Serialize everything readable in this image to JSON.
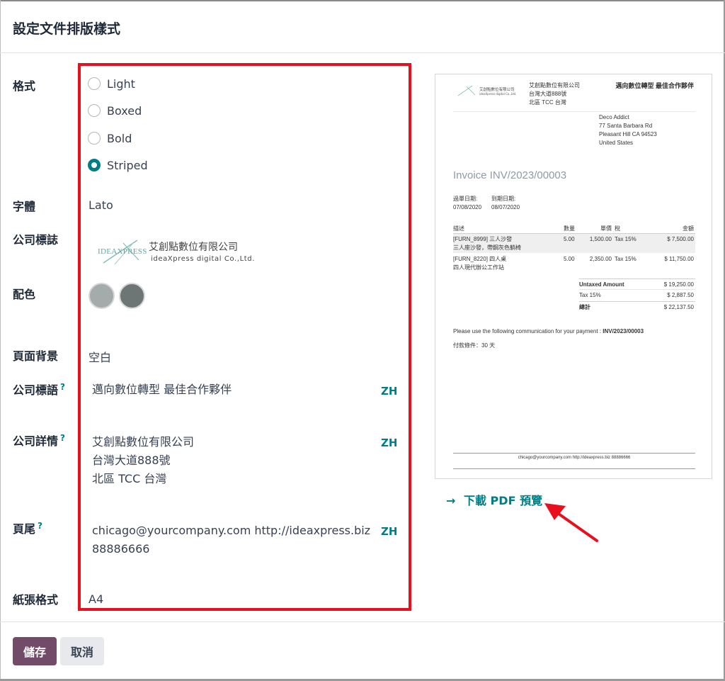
{
  "dialog": {
    "title": "設定文件排版樣式"
  },
  "fields": {
    "layout": {
      "label": "格式",
      "options": [
        "Light",
        "Boxed",
        "Bold",
        "Striped"
      ],
      "selected": "Striped"
    },
    "font": {
      "label": "字體",
      "value": "Lato"
    },
    "logo": {
      "label": "公司標誌",
      "logo_wordmark": "IDEAXPRESS",
      "logo_name_zh": "艾創點數位有限公司",
      "logo_name_en": "ideaXpress digital Co.,Ltd."
    },
    "colors": {
      "label": "配色",
      "primary": "#a3abab",
      "secondary": "#6d7675"
    },
    "background": {
      "label": "頁面背景",
      "value": "空白"
    },
    "tagline": {
      "label": "公司標語",
      "help": "?",
      "value": "邁向數位轉型 最佳合作夥伴",
      "lang": "ZH"
    },
    "company_details": {
      "label": "公司詳情",
      "help": "?",
      "lines": [
        "艾創點數位有限公司",
        "台灣大道888號",
        "北區 TCC 台灣"
      ],
      "lang": "ZH"
    },
    "footer": {
      "label": "頁尾",
      "help": "?",
      "lines": [
        "chicago@yourcompany.com http://ideaxpress.biz",
        "88886666"
      ],
      "lang": "ZH"
    },
    "paper_format": {
      "label": "紙張格式",
      "value": "A4"
    }
  },
  "preview": {
    "logo_name_zh": "艾創點數位有限公司",
    "logo_name_en": "ideaXpress digital Co.,Ltd.",
    "company_lines": [
      "艾創點數位有限公司",
      "台灣大道888號",
      "北區 TCC 台灣"
    ],
    "tagline": "邁向數位轉型 最佳合作夥伴",
    "address_lines": [
      "Deco Addict",
      "77 Santa Barbara Rd",
      "Pleasant Hill CA 94523",
      "United States"
    ],
    "invoice_title": "Invoice INV/2023/00003",
    "invoice_date_label": "過單日期:",
    "invoice_date": "07/08/2020",
    "due_date_label": "到期日期:",
    "due_date": "08/07/2020",
    "table_headers": {
      "description": "描述",
      "quantity": "數量",
      "unit_price": "單價",
      "taxes": "稅",
      "amount": "金額"
    },
    "lines": [
      {
        "desc1": "[FURN_8999] 三人沙發",
        "desc2": "三人座沙發，帶鋼灰色躺椅",
        "qty": "5.00",
        "price": "1,500.00",
        "tax": "Tax 15%",
        "amount": "$ 7,500.00"
      },
      {
        "desc1": "[FURN_8220] 四人桌",
        "desc2": "四人現代辦公工作站",
        "qty": "5.00",
        "price": "2,350.00",
        "tax": "Tax 15%",
        "amount": "$ 11,750.00"
      }
    ],
    "totals": {
      "untaxed_label": "Untaxed Amount",
      "untaxed": "$ 19,250.00",
      "tax_label": "Tax 15%",
      "tax": "$ 2,887.50",
      "total_label": "總計",
      "total": "$ 22,137.50"
    },
    "payment_comm_text": "Please use the following communication for your payment :",
    "payment_comm_ref": "INV/2023/00003",
    "payment_terms": "付款條件：30 天",
    "footer_text": "chicago@yourcompany.com http://ideaxpress.biz 88886666"
  },
  "download_link": {
    "arrow": "→",
    "label": "下載 PDF 預覽"
  },
  "buttons": {
    "save": "儲存",
    "cancel": "取消"
  },
  "theme": {
    "accent": "#017e84",
    "primary_button": "#714b67",
    "highlight_border": "#e8101c"
  }
}
